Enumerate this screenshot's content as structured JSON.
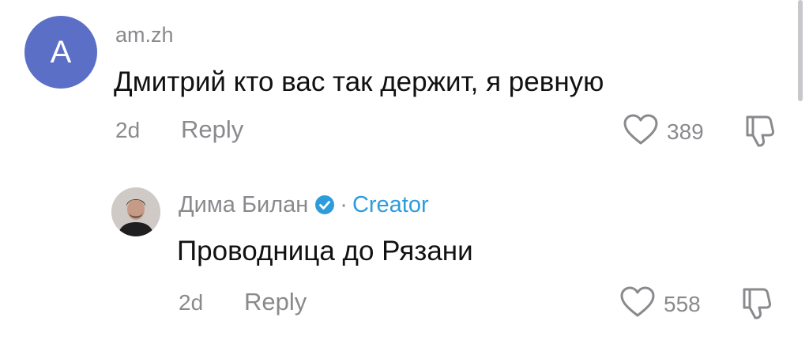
{
  "comment": {
    "avatar_letter": "A",
    "avatar_color": "#5b6fc7",
    "username": "am.zh",
    "text": "Дмитрий кто вас так держит, я ревную",
    "time": "2d",
    "reply_label": "Reply",
    "likes": "389",
    "like_icon": "heart-outline-icon",
    "dislike_icon": "thumbs-down-icon"
  },
  "reply": {
    "username": "Дима Билан",
    "verified_icon": "verified-check-icon",
    "separator": "·",
    "creator_label": "Creator",
    "creator_color": "#2d9cdb",
    "text": "Проводница до Рязани",
    "time": "2d",
    "reply_label": "Reply",
    "likes": "558",
    "like_icon": "heart-outline-icon",
    "dislike_icon": "thumbs-down-icon"
  }
}
